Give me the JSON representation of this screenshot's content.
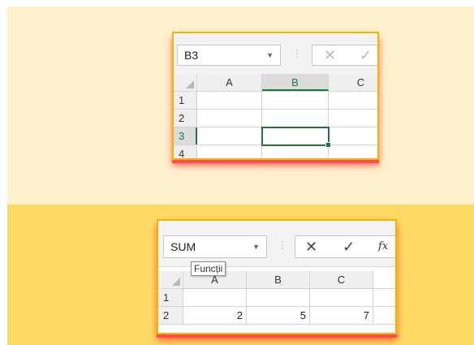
{
  "top": {
    "name_box": "B3",
    "columns": [
      "A",
      "B",
      "C"
    ],
    "rows": [
      "1",
      "2",
      "3",
      "4"
    ],
    "active_cell": "B3"
  },
  "bottom": {
    "name_box": "SUM",
    "tooltip": "Funcții",
    "columns": [
      "A",
      "B",
      "C"
    ],
    "rows": [
      "1",
      "2"
    ],
    "values": {
      "A2": "2",
      "B2": "5",
      "C2": "7"
    }
  },
  "icons": {
    "dropdown": "chevron-down-icon",
    "separator": "vertical-dots-icon",
    "cancel": "cancel-x-icon",
    "enter": "checkmark-icon",
    "insert_function": "fx-icon"
  },
  "colors": {
    "band_top": "#fff1cc",
    "band_bottom": "#ffd966",
    "panel_border": "#f5b400",
    "shadow": "#ff4b4b",
    "excel_green": "#217346"
  }
}
